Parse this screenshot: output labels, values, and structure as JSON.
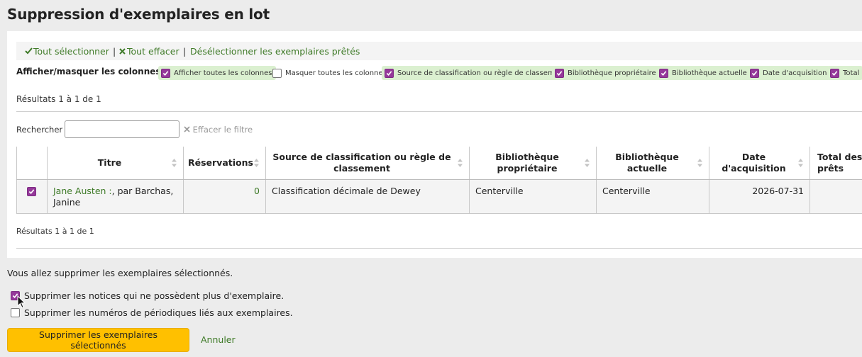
{
  "page": {
    "title": "Suppression d'exemplaires en lot"
  },
  "toolbar": {
    "select_all": "Tout sélectionner",
    "clear_all": "Tout effacer",
    "deselect_checked_out": "Désélectionner les exemplaires prêtés",
    "separator": "|"
  },
  "columns_toggle": {
    "label": "Afficher/masquer les colonnes :",
    "chips": [
      {
        "label": "Afficher toutes les colonnes",
        "checked": true
      },
      {
        "label": "Masquer toutes les colonnes",
        "checked": false
      },
      {
        "label": "Source de classification ou règle de classement",
        "checked": true
      },
      {
        "label": "Bibliothèque propriétaire",
        "checked": true
      },
      {
        "label": "Bibliothèque actuelle",
        "checked": true
      },
      {
        "label": "Date d'acquisition",
        "checked": true
      },
      {
        "label": "Total",
        "checked": true
      }
    ]
  },
  "results": {
    "top": "Résultats 1 à 1 de 1",
    "bottom": "Résultats 1 à 1 de 1"
  },
  "search": {
    "label": "Rechercher :",
    "value": "",
    "clear_filter": "Effacer le filtre"
  },
  "table": {
    "headers": [
      "",
      "Titre",
      "Réservations",
      "Source de classification ou règle de classement",
      "Bibliothèque propriétaire",
      "Bibliothèque actuelle",
      "Date d'acquisition",
      "Total des prêts"
    ],
    "rows": [
      {
        "checked": true,
        "title_link": "Jane Austen :",
        "title_rest": ", par Barchas, Janine",
        "holds": "0",
        "classification": "Classification décimale de Dewey",
        "home_library": "Centerville",
        "current_library": "Centerville",
        "acquisition_date": "2026-07-31",
        "total_checkouts": ""
      }
    ]
  },
  "confirm": {
    "message": "Vous allez supprimer les exemplaires sélectionnés.",
    "delete_records": {
      "label": "Supprimer les notices qui ne possèdent plus d'exemplaire.",
      "checked": true
    },
    "delete_serials": {
      "label": "Supprimer les numéros de périodiques liés aux exemplaires.",
      "checked": false
    },
    "submit": "Supprimer les exemplaires sélectionnés",
    "cancel": "Annuler"
  },
  "colors": {
    "link": "#3e7a27",
    "checkbox": "#95399a",
    "chip": "#dbf0d0",
    "primary_button": "#ffc000"
  }
}
